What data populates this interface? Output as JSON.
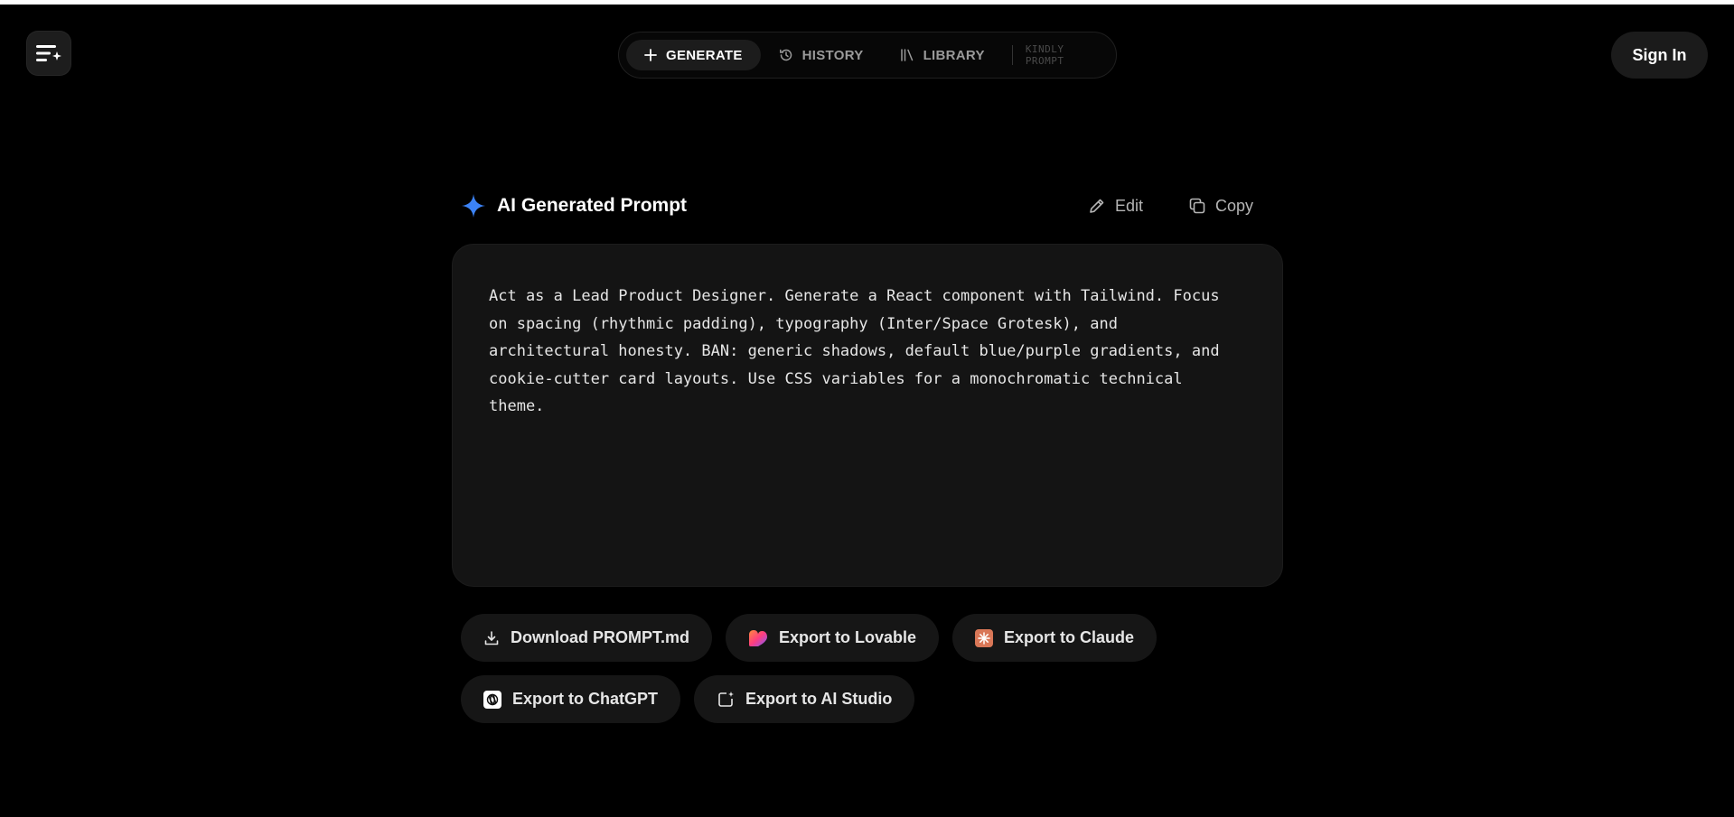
{
  "nav": {
    "items": [
      {
        "label": "GENERATE",
        "icon": "plus-icon",
        "active": true
      },
      {
        "label": "HISTORY",
        "icon": "history-icon",
        "active": false
      },
      {
        "label": "LIBRARY",
        "icon": "library-icon",
        "active": false
      }
    ],
    "brand": "KINDLY PROMPT"
  },
  "auth": {
    "sign_in_label": "Sign In"
  },
  "prompt": {
    "title": "AI Generated Prompt",
    "edit_label": "Edit",
    "copy_label": "Copy",
    "text": "Act as a Lead Product Designer. Generate a React component with Tailwind. Focus\non spacing (rhythmic padding), typography (Inter/Space Grotesk), and\narchitectural honesty. BAN: generic shadows, default blue/purple gradients, and\ncookie-cutter card layouts. Use CSS variables for a monochromatic technical\ntheme."
  },
  "exports": [
    {
      "label": "Download PROMPT.md",
      "icon": "download-icon"
    },
    {
      "label": "Export to Lovable",
      "icon": "lovable-heart-icon"
    },
    {
      "label": "Export to Claude",
      "icon": "claude-icon"
    },
    {
      "label": "Export to ChatGPT",
      "icon": "chatgpt-icon"
    },
    {
      "label": "Export to AI Studio",
      "icon": "ai-studio-icon"
    }
  ],
  "colors": {
    "background": "#000000",
    "surface": "#141414",
    "accent_sparkle": "#3b82f6",
    "claude_orange": "#d97757"
  }
}
